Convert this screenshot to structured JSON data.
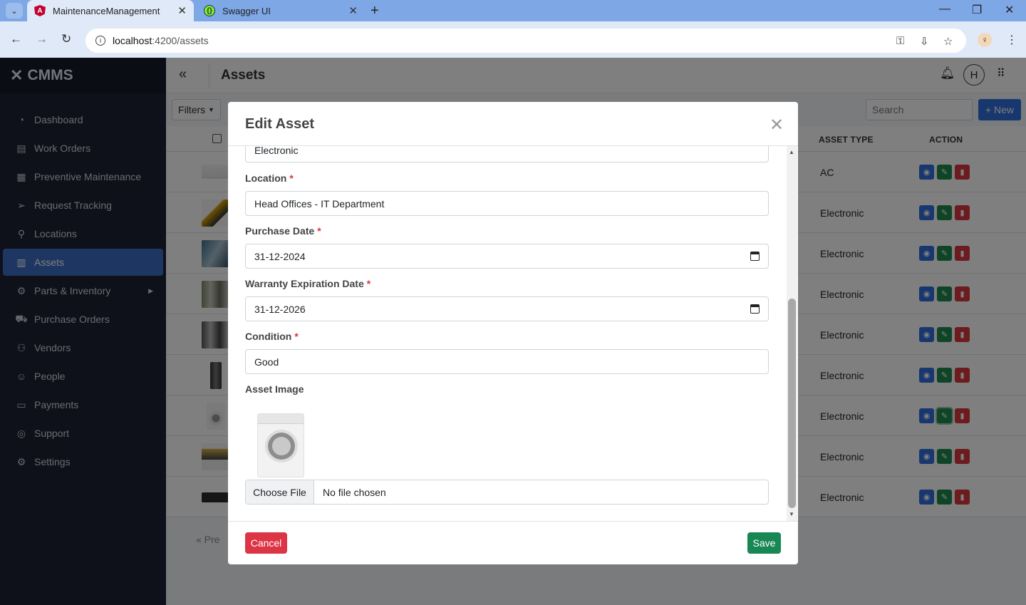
{
  "browser": {
    "tabs": [
      {
        "title": "MaintenanceManagement",
        "active": true
      },
      {
        "title": "Swagger UI",
        "active": false
      }
    ],
    "url_host": "localhost",
    "url_path": ":4200/assets"
  },
  "sidebar": {
    "brand": "CMMS",
    "items": [
      {
        "label": "Dashboard",
        "icon": "gauge-icon"
      },
      {
        "label": "Work Orders",
        "icon": "clipboard-icon"
      },
      {
        "label": "Preventive Maintenance",
        "icon": "calendar-icon"
      },
      {
        "label": "Request Tracking",
        "icon": "send-icon"
      },
      {
        "label": "Locations",
        "icon": "map-pin-icon"
      },
      {
        "label": "Assets",
        "icon": "boxes-icon",
        "active": true
      },
      {
        "label": "Parts & Inventory",
        "icon": "parts-icon"
      },
      {
        "label": "Purchase Orders",
        "icon": "cart-icon"
      },
      {
        "label": "Vendors",
        "icon": "vendors-icon"
      },
      {
        "label": "People",
        "icon": "people-icon"
      },
      {
        "label": "Payments",
        "icon": "card-icon"
      },
      {
        "label": "Support",
        "icon": "lifebuoy-icon"
      },
      {
        "label": "Settings",
        "icon": "gear-icon"
      }
    ]
  },
  "header": {
    "title": "Assets",
    "avatar_initial": "H"
  },
  "toolbar": {
    "filters_label": "Filters",
    "search_placeholder": "Search",
    "new_label": "+ New"
  },
  "table": {
    "columns": {
      "asset_type": "ASSET TYPE",
      "action": "ACTION"
    },
    "rows": [
      {
        "asset_type": "AC"
      },
      {
        "asset_type": "Electronic"
      },
      {
        "asset_type": "Electronic"
      },
      {
        "asset_type": "Electronic"
      },
      {
        "asset_type": "Electronic"
      },
      {
        "asset_type": "Electronic"
      },
      {
        "asset_type": "Electronic"
      },
      {
        "asset_type": "Electronic"
      },
      {
        "asset_type": "Electronic"
      }
    ],
    "pager_text": "«  Pre"
  },
  "modal": {
    "title": "Edit Asset",
    "asset_type_value": "Electronic",
    "location_label": "Location",
    "location_value": "Head Offices - IT Department",
    "purchase_date_label": "Purchase Date",
    "purchase_date_value": "31-12-2024",
    "warranty_label": "Warranty Expiration Date",
    "warranty_value": "31-12-2026",
    "condition_label": "Condition",
    "condition_value": "Good",
    "image_label": "Asset Image",
    "choose_file_label": "Choose File",
    "file_status": "No file chosen",
    "required_mark": "*",
    "cancel_label": "Cancel",
    "save_label": "Save"
  },
  "colors": {
    "sidebar_bg": "#1c2333",
    "active_nav": "#3a6fc4",
    "primary": "#2e6fdc",
    "success": "#198754",
    "danger": "#dc3545"
  }
}
